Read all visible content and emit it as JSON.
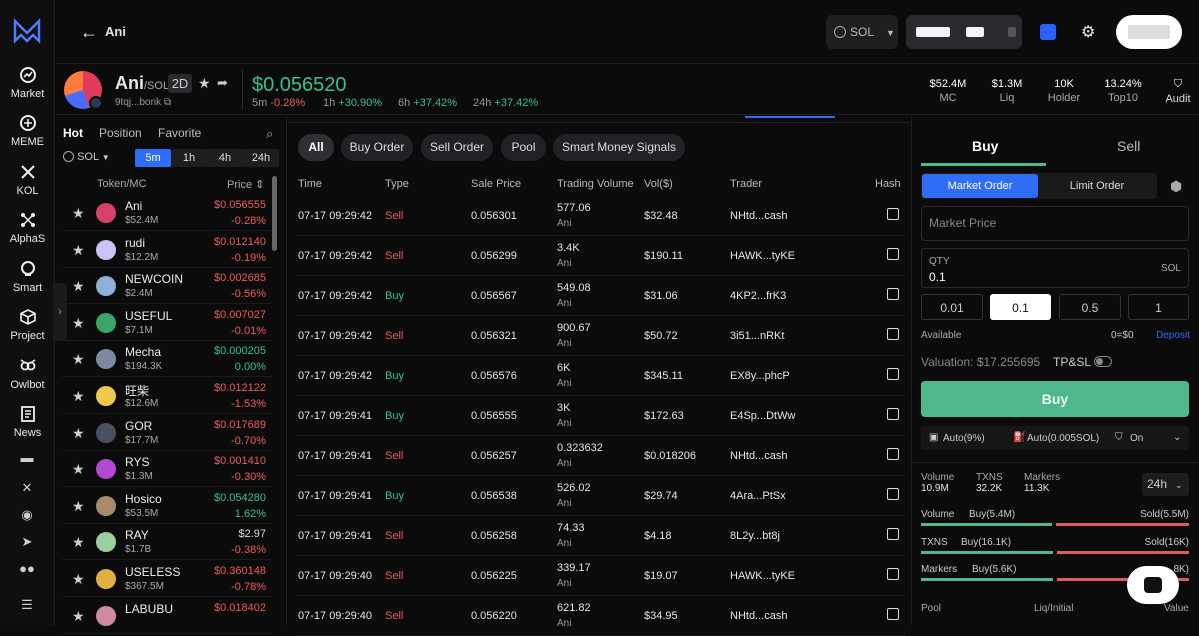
{
  "nav": {
    "items": [
      {
        "label": "Market"
      },
      {
        "label": "MEME"
      },
      {
        "label": "KOL"
      },
      {
        "label": "AlphaS"
      },
      {
        "label": "Smart"
      },
      {
        "label": "Project"
      },
      {
        "label": "Owlbot"
      },
      {
        "label": "News"
      }
    ]
  },
  "header": {
    "title": "Ani",
    "chain": "SOL"
  },
  "token": {
    "name": "Ani",
    "pair": "/SOL",
    "tag": "2D",
    "address": "9tqj...bonk",
    "price": "$0.056520",
    "changes": [
      {
        "label": "5m",
        "value": "-0.28%",
        "dir": "neg"
      },
      {
        "label": "1h",
        "value": "+30.90%",
        "dir": "pos"
      },
      {
        "label": "6h",
        "value": "+37.42%",
        "dir": "pos"
      },
      {
        "label": "24h",
        "value": "+37.42%",
        "dir": "pos"
      }
    ],
    "stats": [
      {
        "value": "$52.4M",
        "label": "MC"
      },
      {
        "value": "$1.3M",
        "label": "Liq"
      },
      {
        "value": "10K",
        "label": "Holder"
      },
      {
        "value": "13.24%",
        "label": "Top10"
      },
      {
        "value": "",
        "label": "Audit"
      }
    ]
  },
  "left": {
    "tabs": [
      "Hot",
      "Position",
      "Favorite"
    ],
    "chain": "SOL",
    "timeframes": [
      "5m",
      "1h",
      "4h",
      "24h"
    ],
    "col_token": "Token/MC",
    "col_price": "Price",
    "rows": [
      {
        "name": "Ani",
        "mc": "$52.4M",
        "price": "$0.056555",
        "chg": "-0.28%",
        "dir": "neg",
        "color": "#d6416a"
      },
      {
        "name": "rudi",
        "mc": "$12.2M",
        "price": "$0.012140",
        "chg": "-0.19%",
        "dir": "neg",
        "color": "#c9c4f5"
      },
      {
        "name": "NEWCOIN",
        "mc": "$2.4M",
        "price": "$0.002685",
        "chg": "-0.56%",
        "dir": "neg",
        "color": "#8fb0d8"
      },
      {
        "name": "USEFUL",
        "mc": "$7.1M",
        "price": "$0.007027",
        "chg": "-0.01%",
        "dir": "neg",
        "color": "#3aa46b"
      },
      {
        "name": "Mecha",
        "mc": "$194.3K",
        "price": "$0.000205",
        "chg": "0.00%",
        "dir": "pos",
        "color": "#7a8aa0"
      },
      {
        "name": "旺柴",
        "mc": "$12.6M",
        "price": "$0.012122",
        "chg": "-1.53%",
        "dir": "neg",
        "color": "#f0c84a"
      },
      {
        "name": "GOR",
        "mc": "$17.7M",
        "price": "$0.017689",
        "chg": "-0.70%",
        "dir": "neg",
        "color": "#4a5060"
      },
      {
        "name": "RYS",
        "mc": "$1.3M",
        "price": "$0.001410",
        "chg": "-0.30%",
        "dir": "neg",
        "color": "#b04ad0"
      },
      {
        "name": "Hosico",
        "mc": "$53.5M",
        "price": "$0.054280",
        "chg": "1.62%",
        "dir": "pos",
        "color": "#a88c6a"
      },
      {
        "name": "RAY",
        "mc": "$1.7B",
        "price": "$2.97",
        "chg": "-0.38%",
        "dir": "neg",
        "color": "#9ad0a0"
      },
      {
        "name": "USELESS",
        "mc": "$367.5M",
        "price": "$0.360148",
        "chg": "-0.78%",
        "dir": "neg",
        "color": "#e0b040"
      },
      {
        "name": "LABUBU",
        "mc": "",
        "price": "$0.018402",
        "chg": "",
        "dir": "neg",
        "color": "#d08aa0"
      }
    ]
  },
  "trades": {
    "filters": [
      "All",
      "Buy Order",
      "Sell Order",
      "Pool",
      "Smart Money Signals"
    ],
    "headers": [
      "Time",
      "Type",
      "Sale Price",
      "Trading Volume",
      "Vol($)",
      "Trader",
      "Hash"
    ],
    "rows": [
      {
        "time": "07-17 09:29:42",
        "type": "Sell",
        "price": "0.056301",
        "vol": "577.06",
        "unit": "Ani",
        "usd": "$32.48",
        "trader": "NHtd...cash"
      },
      {
        "time": "07-17 09:29:42",
        "type": "Sell",
        "price": "0.056299",
        "vol": "3.4K",
        "unit": "Ani",
        "usd": "$190.11",
        "trader": "HAWK...tyKE"
      },
      {
        "time": "07-17 09:29:42",
        "type": "Buy",
        "price": "0.056567",
        "vol": "549.08",
        "unit": "Ani",
        "usd": "$31.06",
        "trader": "4KP2...frK3"
      },
      {
        "time": "07-17 09:29:42",
        "type": "Sell",
        "price": "0.056321",
        "vol": "900.67",
        "unit": "Ani",
        "usd": "$50.72",
        "trader": "3i51...nRKt"
      },
      {
        "time": "07-17 09:29:42",
        "type": "Buy",
        "price": "0.056576",
        "vol": "6K",
        "unit": "Ani",
        "usd": "$345.11",
        "trader": "EX8y...phcP"
      },
      {
        "time": "07-17 09:29:41",
        "type": "Buy",
        "price": "0.056555",
        "vol": "3K",
        "unit": "Ani",
        "usd": "$172.63",
        "trader": "E4Sp...DtWw"
      },
      {
        "time": "07-17 09:29:41",
        "type": "Sell",
        "price": "0.056257",
        "vol": "0.323632",
        "unit": "Ani",
        "usd": "$0.018206",
        "trader": "NHtd...cash"
      },
      {
        "time": "07-17 09:29:41",
        "type": "Buy",
        "price": "0.056538",
        "vol": "526.02",
        "unit": "Ani",
        "usd": "$29.74",
        "trader": "4Ara...PtSx"
      },
      {
        "time": "07-17 09:29:41",
        "type": "Sell",
        "price": "0.056258",
        "vol": "74.33",
        "unit": "Ani",
        "usd": "$4.18",
        "trader": "8L2y...bt8j"
      },
      {
        "time": "07-17 09:29:40",
        "type": "Sell",
        "price": "0.056225",
        "vol": "339.17",
        "unit": "Ani",
        "usd": "$19.07",
        "trader": "HAWK...tyKE"
      },
      {
        "time": "07-17 09:29:40",
        "type": "Sell",
        "price": "0.056220",
        "vol": "621.82",
        "unit": "Ani",
        "usd": "$34.95",
        "trader": "NHtd...cash"
      }
    ]
  },
  "trade_panel": {
    "buy": "Buy",
    "sell": "Sell",
    "market_order": "Market Order",
    "limit_order": "Limit Order",
    "market_price": "Market Price",
    "qty_label": "QTY",
    "qty_value": "0.1",
    "qty_unit": "SOL",
    "quick": [
      "0.01",
      "0.1",
      "0.5",
      "1"
    ],
    "available_label": "Available",
    "available_value": "0=$0",
    "deposit": "Deposit",
    "valuation": "Valuation: $17.255695",
    "tpsl": "TP&SL",
    "buy_button": "Buy",
    "auto1": "Auto(9%)",
    "auto2": "Auto(0.005SOL)",
    "on": "On",
    "stats": [
      {
        "label": "Volume",
        "value": "10.9M"
      },
      {
        "label": "TXNS",
        "value": "32.2K"
      },
      {
        "label": "Markers",
        "value": "11.3K"
      }
    ],
    "period": "24h",
    "bars": [
      {
        "label": "Volume",
        "buy": "Buy(5.4M)",
        "sell": "Sold(5.5M)",
        "buy_frac": 0.495
      },
      {
        "label": "TXNS",
        "buy": "Buy(16.1K)",
        "sell": "Sold(16K)",
        "buy_frac": 0.5
      },
      {
        "label": "Markers",
        "buy": "Buy(5.6K)",
        "sell": "8K)",
        "buy_frac": 0.5
      }
    ],
    "footer": [
      "Pool",
      "Liq/Initial",
      "Value"
    ]
  },
  "colors": {
    "green": "#37c28a",
    "red": "#ec5b5b",
    "accent": "#2f6df6"
  }
}
